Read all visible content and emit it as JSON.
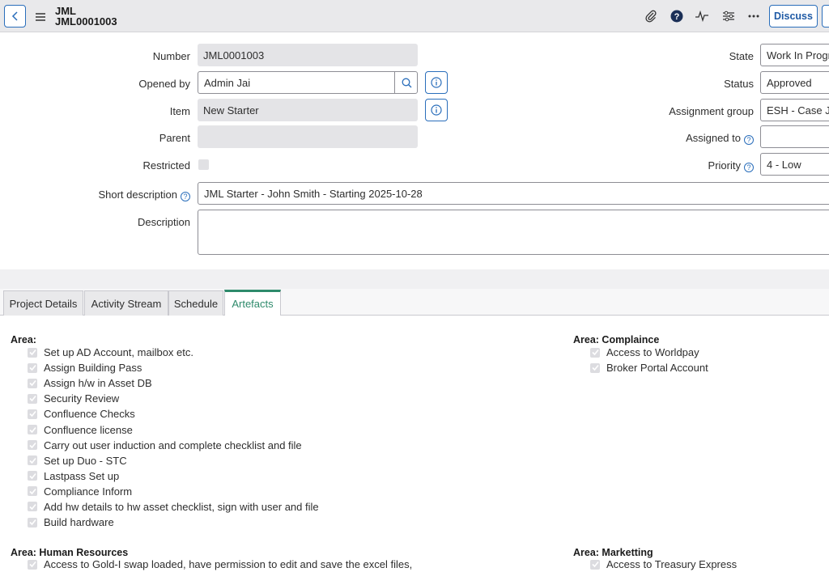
{
  "header": {
    "title_line1": "JML",
    "title_line2": "JML0001003",
    "discuss_label": "Discuss"
  },
  "form": {
    "number": {
      "label": "Number",
      "value": "JML0001003"
    },
    "opened_by": {
      "label": "Opened by",
      "value": "Admin Jai"
    },
    "item": {
      "label": "Item",
      "value": "New Starter"
    },
    "parent": {
      "label": "Parent",
      "value": ""
    },
    "restricted": {
      "label": "Restricted"
    },
    "short_description": {
      "label": "Short description",
      "value": "JML Starter - John Smith - Starting 2025-10-28"
    },
    "description": {
      "label": "Description",
      "value": ""
    },
    "state": {
      "label": "State",
      "value": "Work In Progress"
    },
    "status": {
      "label": "Status",
      "value": "Approved"
    },
    "assignment_group": {
      "label": "Assignment group",
      "value": "ESH - Case JML"
    },
    "assigned_to": {
      "label": "Assigned to",
      "value": ""
    },
    "priority": {
      "label": "Priority",
      "value": "4 - Low"
    }
  },
  "tabs": [
    {
      "label": "Project Details"
    },
    {
      "label": "Activity Stream"
    },
    {
      "label": "Schedule"
    },
    {
      "label": "Artefacts"
    }
  ],
  "artefacts": {
    "area_general": {
      "title": "Area:",
      "items": [
        "Set up AD Account, mailbox etc.",
        "Assign Building Pass",
        "Assign h/w in Asset DB",
        "Security Review",
        "Confluence Checks",
        "Confluence license",
        "Carry out user induction and complete checklist and file",
        "Set up Duo - STC",
        "Lastpass Set up",
        "Compliance Inform",
        "Add hw details to hw asset checklist, sign with user and file",
        "Build hardware"
      ]
    },
    "area_compliance": {
      "title": "Area: Complaince",
      "items": [
        "Access to Worldpay",
        "Broker Portal Account"
      ]
    },
    "area_hr": {
      "title": "Area: Human Resources",
      "items": [
        "Access to Gold-I swap loaded, have permission to edit and save the excel files,"
      ]
    },
    "area_marketing": {
      "title": "Area: Marketting",
      "items": [
        "Access to Treasury Express"
      ]
    }
  }
}
